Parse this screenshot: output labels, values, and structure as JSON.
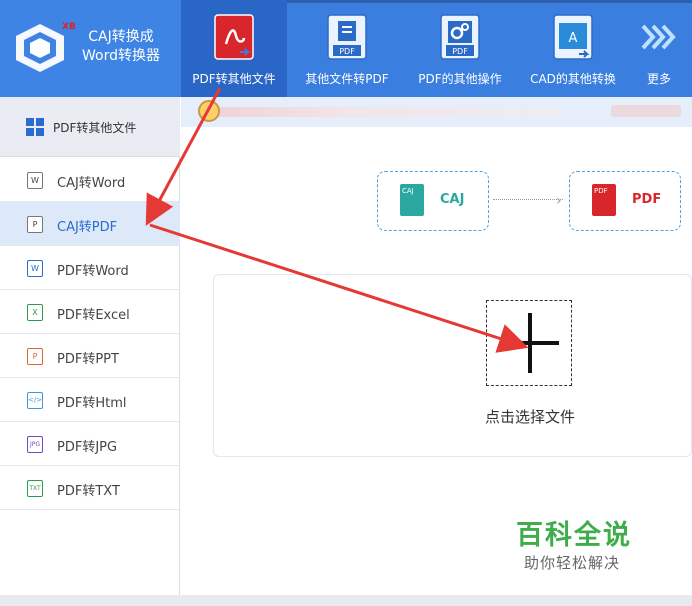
{
  "logo": {
    "tag": "XB",
    "line1": "CAJ转换成",
    "line2": "Word转换器",
    "icon": "cube-logo-icon"
  },
  "toolbar": {
    "items": [
      {
        "label": "PDF转其他文件",
        "icon": "pdf-icon",
        "color": "#d8262c"
      },
      {
        "label": "其他文件转PDF",
        "icon": "document-icon",
        "color": "#2a6bc8"
      },
      {
        "label": "PDF的其他操作",
        "icon": "gears-icon",
        "color": "#2a6bc8"
      },
      {
        "label": "CAD的其他转换",
        "icon": "cad-icon",
        "color": "#2a6bc8"
      },
      {
        "label": "更多",
        "icon": "chevrons-right-icon",
        "color": "#bfe0ff"
      }
    ]
  },
  "sidebar": {
    "header": {
      "label": "PDF转其他文件",
      "icon": "grid-icon"
    },
    "items": [
      {
        "label": "CAJ转Word",
        "icon": "caj-word-icon",
        "glyph": "W"
      },
      {
        "label": "CAJ转PDF",
        "icon": "caj-pdf-icon",
        "glyph": "P"
      },
      {
        "label": "PDF转Word",
        "icon": "word-icon",
        "glyph": "W"
      },
      {
        "label": "PDF转Excel",
        "icon": "excel-icon",
        "glyph": "X"
      },
      {
        "label": "PDF转PPT",
        "icon": "ppt-icon",
        "glyph": "P"
      },
      {
        "label": "PDF转Html",
        "icon": "html-icon",
        "glyph": "</>"
      },
      {
        "label": "PDF转JPG",
        "icon": "jpg-icon",
        "glyph": "JPG"
      },
      {
        "label": "PDF转TXT",
        "icon": "txt-icon",
        "glyph": "TXT"
      }
    ]
  },
  "conversion": {
    "from": {
      "label": "CAJ",
      "badge": "CAJ",
      "color": "#2aa8a0"
    },
    "to": {
      "label": "PDF",
      "badge": "PDF",
      "color": "#d8262c"
    }
  },
  "dropzone": {
    "label": "点击选择文件"
  },
  "watermark": {
    "title": "百科全说",
    "subtitle": "助你轻松解决"
  },
  "colors": {
    "accent": "#3a7fe0",
    "annotation": "#e53935"
  }
}
